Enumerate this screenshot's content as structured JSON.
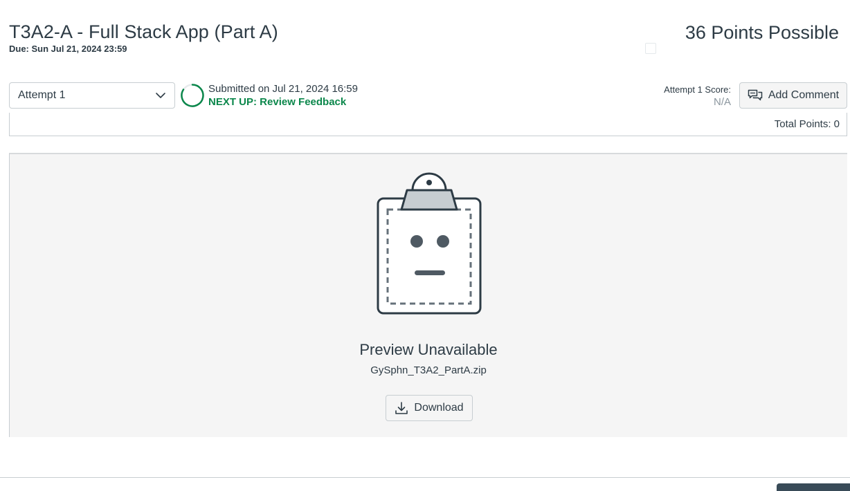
{
  "assignment": {
    "title": "T3A2-A - Full Stack App (Part A)",
    "due": "Due: Sun Jul 21, 2024 23:59",
    "points_possible": "36 Points Possible"
  },
  "attempt": {
    "selected": "Attempt 1",
    "icon": "chevron-down-icon"
  },
  "submission": {
    "submitted_text": "Submitted on Jul 21, 2024 16:59",
    "next_up": "NEXT UP: Review Feedback",
    "progress_color": "#0b874b"
  },
  "score": {
    "label": "Attempt 1 Score:",
    "value": "N/A"
  },
  "add_comment": {
    "label": "Add Comment",
    "icon": "comments-icon"
  },
  "total": {
    "label": "Total Points: 0"
  },
  "preview": {
    "icon": "clipboard-unavailable-icon",
    "title": "Preview Unavailable",
    "filename": "GySphn_T3A2_PartA.zip",
    "download_label": "Download",
    "download_icon": "download-icon"
  },
  "colors": {
    "text": "#2d3b45",
    "accent_green": "#0b874b",
    "muted": "#8b969e",
    "border": "#c7cdd1",
    "preview_bg": "#f5f5f5"
  }
}
